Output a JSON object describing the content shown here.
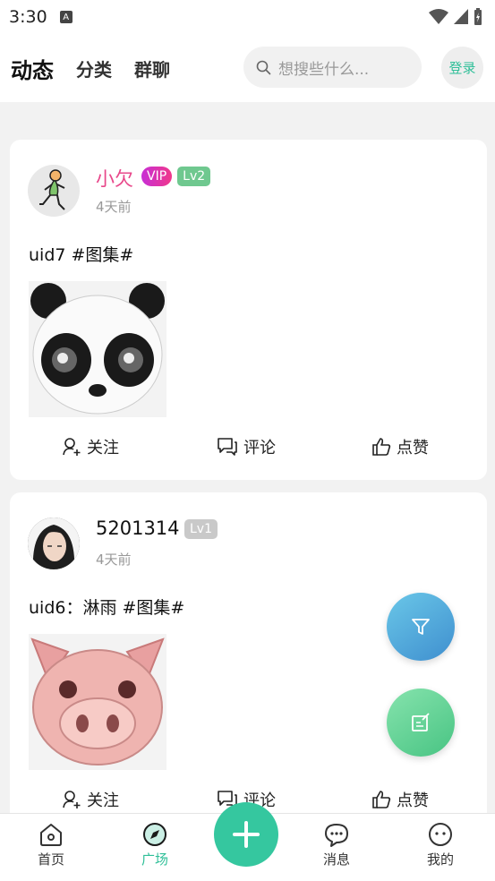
{
  "status_bar": {
    "time": "3:30",
    "app_icon": "A"
  },
  "header": {
    "tabs": [
      {
        "label": "动态",
        "active": true
      },
      {
        "label": "分类",
        "active": false
      },
      {
        "label": "群聊",
        "active": false
      }
    ],
    "search_placeholder": "想搜些什么...",
    "login_label": "登录"
  },
  "posts": [
    {
      "username": "小欠",
      "badges": [
        "VIP",
        "Lv2"
      ],
      "time": "4天前",
      "text": "uid7 #图集#",
      "image": "panda-emoji",
      "actions": {
        "follow": "关注",
        "comment": "评论",
        "like": "点赞"
      }
    },
    {
      "username": "5201314",
      "badges": [
        "Lv1"
      ],
      "time": "4天前",
      "text": "uid6：淋雨 #图集#",
      "image": "pig-emoji",
      "actions": {
        "follow": "关注",
        "comment": "评论",
        "like": "点赞"
      }
    }
  ],
  "bottom_nav": [
    {
      "label": "首页",
      "icon": "home-icon"
    },
    {
      "label": "广场",
      "icon": "compass-icon",
      "active": true
    },
    {
      "label": "消息",
      "icon": "message-icon"
    },
    {
      "label": "我的",
      "icon": "profile-icon"
    }
  ],
  "colors": {
    "accent": "#35c79f",
    "vip_name": "#e8478a",
    "filter_fab": "#4fa6da",
    "edit_fab": "#5fd192"
  }
}
